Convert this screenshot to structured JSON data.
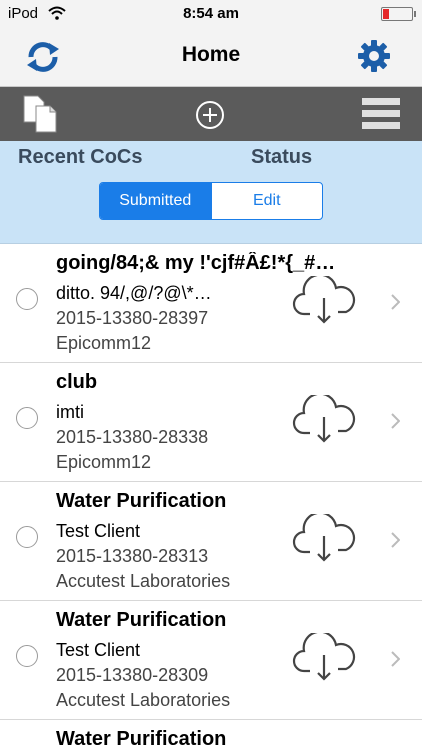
{
  "status_bar": {
    "carrier": "iPod",
    "time": "8:54 am"
  },
  "navbar": {
    "title": "Home",
    "left_icon": "refresh-icon",
    "right_icon": "gear-icon"
  },
  "toolbar": {
    "icons": [
      "copy-icon",
      "add-icon",
      "menu-icon"
    ]
  },
  "header": {
    "recent_label": "Recent CoCs",
    "status_label": "Status"
  },
  "segmented": {
    "submitted": "Submitted",
    "edit": "Edit",
    "selected": "Submitted"
  },
  "items": [
    {
      "title": "going/84;& my !'cjf#Â£!*{_#…",
      "client": "ditto. 94/,@/?@\\*…",
      "id": "2015-13380-28397",
      "company": "Epicomm12"
    },
    {
      "title": "club",
      "client": "imti",
      "id": "2015-13380-28338",
      "company": "Epicomm12"
    },
    {
      "title": "Water Purification",
      "client": "Test Client",
      "id": "2015-13380-28313",
      "company": "Accutest Laboratories"
    },
    {
      "title": "Water Purification",
      "client": "Test Client",
      "id": "2015-13380-28309",
      "company": "Accutest Laboratories"
    },
    {
      "title": "Water Purification"
    }
  ],
  "colors": {
    "accent": "#1a7de8",
    "header_bg": "#c9e3f7",
    "toolbar_bg": "#5b5b5b"
  }
}
